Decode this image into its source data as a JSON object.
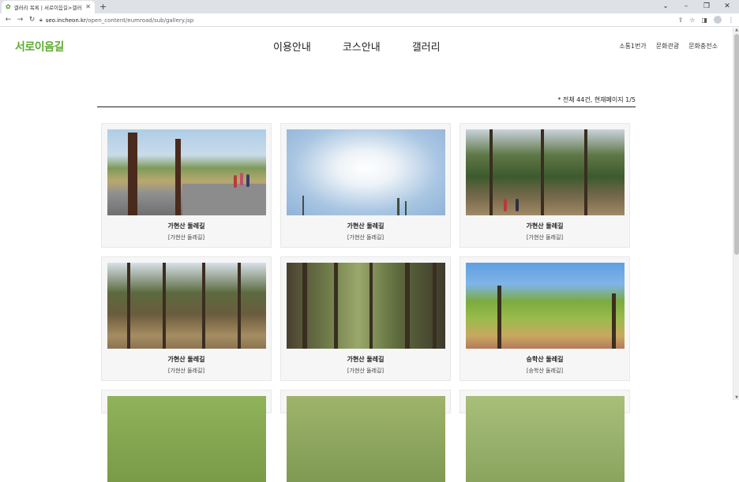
{
  "browser": {
    "tab_title": "갤러리 목록 | 서로이음길>갤러리",
    "url_host": "seo.incheon.kr",
    "url_path": "/open_content/eumroad/sub/gallery.jsp"
  },
  "site": {
    "logo": "서로이음길",
    "nav": [
      "이용안내",
      "코스안내",
      "갤러리"
    ],
    "util_links": [
      "소통1번가",
      "문화관광",
      "문화충전소"
    ]
  },
  "gallery": {
    "count_text": "* 전체 44건, 현재페이지 1/5",
    "items": [
      {
        "title": "가현산 둘레길",
        "subtitle": "[가현산 둘레길]"
      },
      {
        "title": "가현산 둘레길",
        "subtitle": "[가현산 둘레길]"
      },
      {
        "title": "가현산 둘레길",
        "subtitle": "[가현산 둘레길]"
      },
      {
        "title": "가현산 둘레길",
        "subtitle": "[가현산 둘레길]"
      },
      {
        "title": "가현산 둘레길",
        "subtitle": "[가현산 둘레길]"
      },
      {
        "title": "승학산 둘레길",
        "subtitle": "[승학산 둘레길]"
      }
    ]
  }
}
